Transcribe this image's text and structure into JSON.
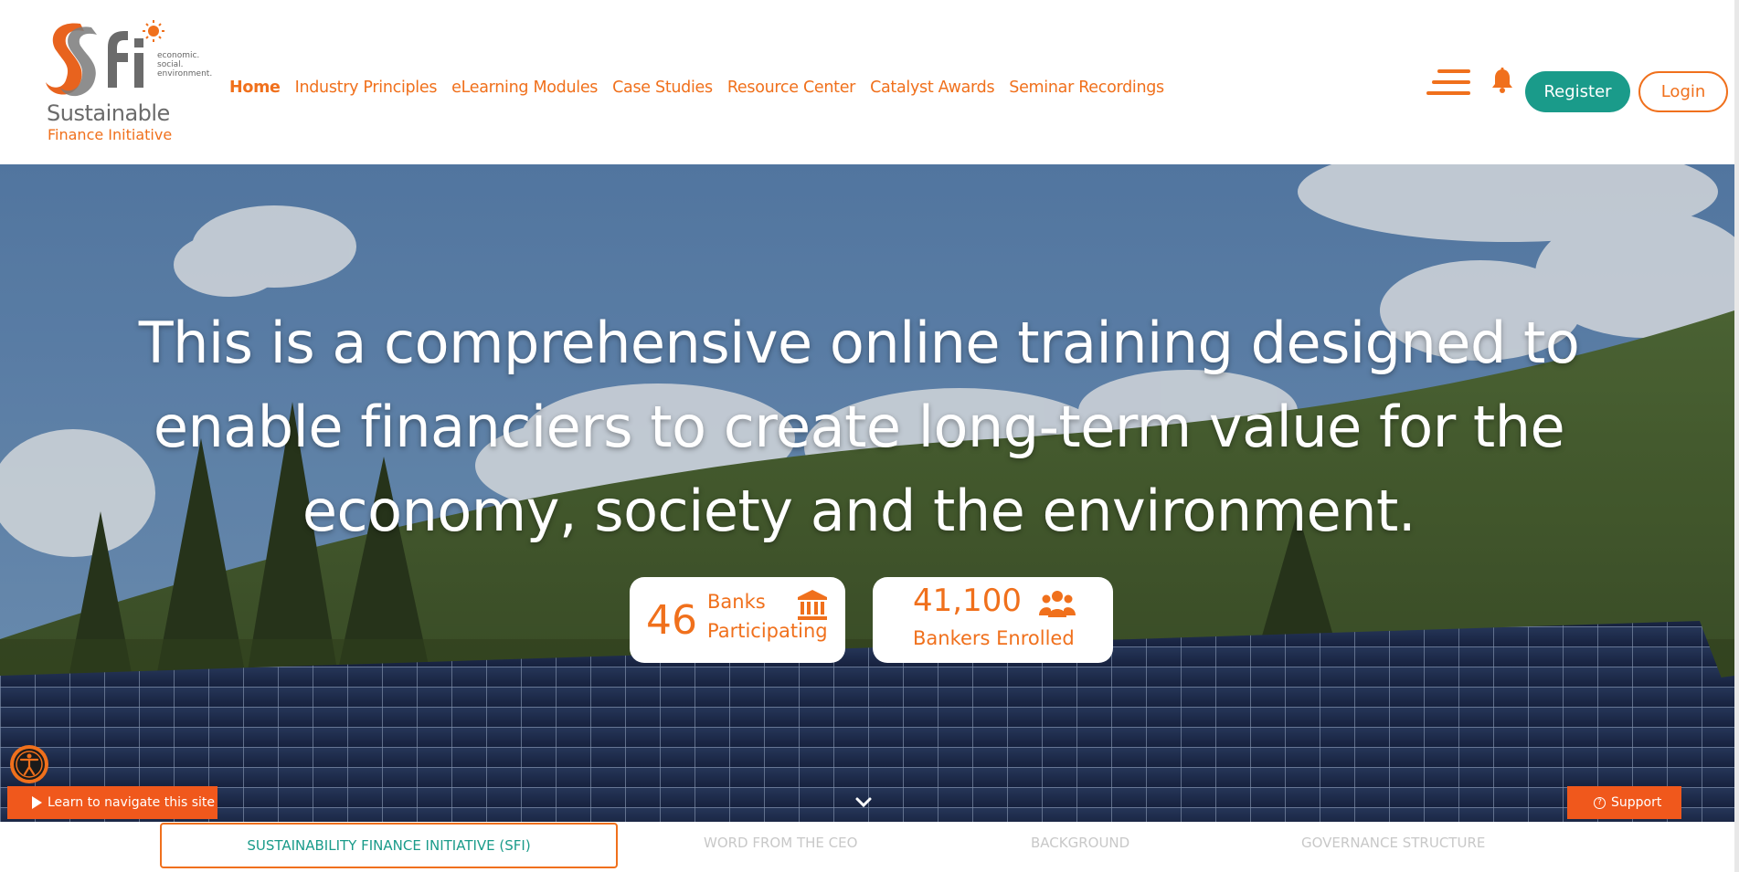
{
  "brand": {
    "monogram": "Sfi",
    "tagline": [
      "economic.",
      "social.",
      "environment."
    ],
    "name": "Sustainable",
    "subname": "Finance Initiative",
    "accent_color": "#f0701c",
    "teal_color": "#1a9b8a"
  },
  "nav": {
    "items": [
      {
        "label": "Home",
        "active": true
      },
      {
        "label": "Industry Principles"
      },
      {
        "label": "eLearning Modules"
      },
      {
        "label": "Case Studies"
      },
      {
        "label": "Resource Center"
      },
      {
        "label": "Catalyst Awards"
      },
      {
        "label": "Seminar Recordings"
      }
    ]
  },
  "header_actions": {
    "menu_icon": "hamburger-menu-icon",
    "bell_icon": "bell-icon",
    "register_label": "Register",
    "login_label": "Login"
  },
  "hero": {
    "title": "This is a comprehensive online training designed to enable financiers to create long-term value for the economy, society and the environment.",
    "stats": {
      "banks": {
        "value": "46",
        "label_1": "Banks",
        "label_2": "Participating",
        "icon": "bank-icon"
      },
      "bankers": {
        "value": "41,100",
        "label": "Bankers Enrolled",
        "icon": "people-icon"
      }
    },
    "learn_label": "Learn to navigate this site",
    "support_label": "Support",
    "accessibility_icon": "accessibility-icon",
    "scroll_icon": "chevron-down-icon"
  },
  "tabs": [
    {
      "label": "SUSTAINABILITY FINANCE INITIATIVE (SFI)",
      "active": true
    },
    {
      "label": "WORD FROM THE CEO"
    },
    {
      "label": "BACKGROUND"
    },
    {
      "label": "GOVERNANCE STRUCTURE"
    }
  ]
}
